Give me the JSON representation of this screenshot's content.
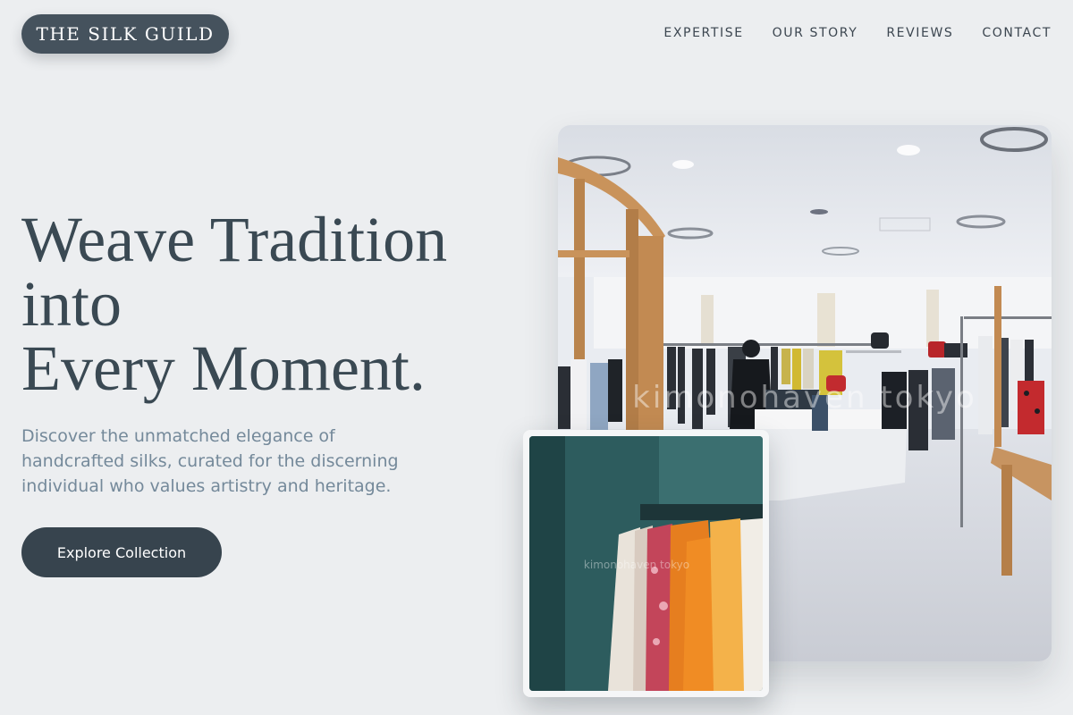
{
  "brand": {
    "name": "THE SILK GUILD"
  },
  "nav": {
    "items": [
      {
        "label": "EXPERTISE"
      },
      {
        "label": "OUR STORY"
      },
      {
        "label": "REVIEWS"
      },
      {
        "label": "CONTACT"
      }
    ]
  },
  "hero": {
    "headline_lines": [
      "Weave Tradition",
      "into",
      "Every Moment."
    ],
    "subtext": "Discover the unmatched elegance of handcrafted silks, curated for the discerning individual who values artistry and heritage.",
    "cta_label": "Explore Collection"
  },
  "images": {
    "main": {
      "watermark": "kimonohaven tokyo"
    },
    "inset": {
      "watermark": "kimonohaven tokyo"
    }
  },
  "colors": {
    "background": "#eceef0",
    "primary_dark": "#37444e",
    "headline": "#3a4953",
    "subtext": "#74899a"
  }
}
